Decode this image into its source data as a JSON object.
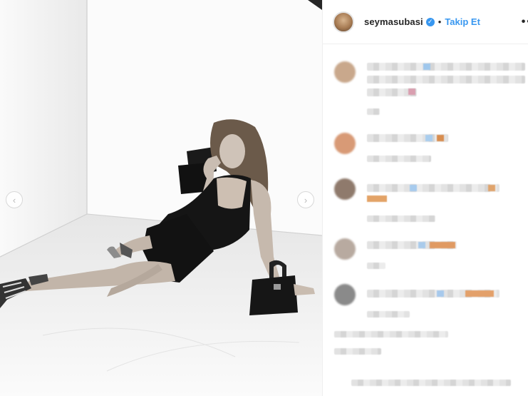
{
  "post": {
    "username": "seymasubasi",
    "verified_mark": "✓",
    "separator": "•",
    "follow_label": "Takip Et",
    "more_label": "••"
  },
  "carousel": {
    "prev_glyph": "‹",
    "next_glyph": "›"
  },
  "icons": [
    "verified-badge-icon",
    "chevron-left-icon",
    "chevron-right-icon",
    "more-options-icon"
  ],
  "colors": {
    "accent": "#3897f0",
    "text": "#262626",
    "divider": "#efefef"
  }
}
